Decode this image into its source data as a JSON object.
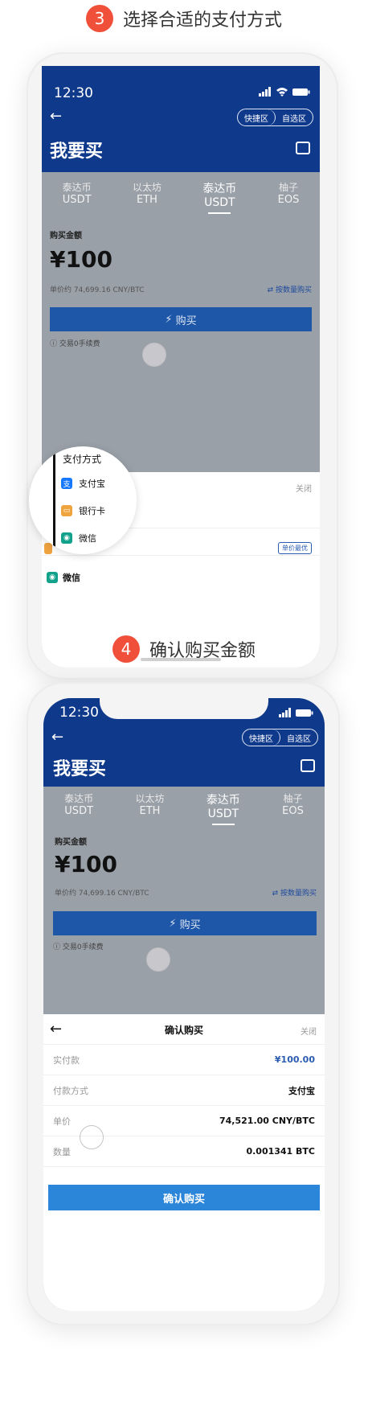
{
  "step3": {
    "num": "3",
    "title": "选择合适的支付方式"
  },
  "step4": {
    "num": "4",
    "title": "确认购买金额"
  },
  "phone1": {
    "time": "12:30",
    "seg": {
      "on": "快捷区",
      "off": "自选区"
    },
    "title": "我要买",
    "coins": [
      {
        "name": "泰达币",
        "sym": "USDT"
      },
      {
        "name": "以太坊",
        "sym": "ETH"
      },
      {
        "name": "泰达币",
        "sym": "USDT",
        "active": true
      },
      {
        "name": "柚子",
        "sym": "EOS"
      }
    ],
    "amount_label": "购买金额",
    "amount": "¥100",
    "rate": "单价约 74,699.16 CNY/BTC",
    "by_qty": "⇄ 按数量购买",
    "buy": "购买",
    "fee": "交易0手续费",
    "sheet": {
      "close": "关闭",
      "tag": "单价最优",
      "wechat": "微信"
    },
    "magnifier": {
      "header": "支付方式",
      "items": [
        {
          "label": "支付宝",
          "icon": "alipay-icon",
          "color": "#1677ff",
          "glyph": "支"
        },
        {
          "label": "银行卡",
          "icon": "bank-card-icon",
          "color": "#f0a440",
          "glyph": "▭"
        },
        {
          "label": "微信",
          "icon": "wechat-icon",
          "color": "#12a28c",
          "glyph": "◉"
        }
      ]
    }
  },
  "phone2": {
    "time": "12:30",
    "seg": {
      "on": "快捷区",
      "off": "自选区"
    },
    "title": "我要买",
    "coins": [
      {
        "name": "泰达币",
        "sym": "USDT"
      },
      {
        "name": "以太坊",
        "sym": "ETH"
      },
      {
        "name": "泰达币",
        "sym": "USDT",
        "active": true
      },
      {
        "name": "柚子",
        "sym": "EOS"
      }
    ],
    "amount_label": "购买金额",
    "amount": "¥100",
    "rate": "单价约 74,699.16 CNY/BTC",
    "by_qty": "⇄ 按数量购买",
    "buy": "购买",
    "fee": "交易0手续费",
    "confirm": {
      "title": "确认购买",
      "close": "关闭",
      "rows": [
        {
          "label": "实付款",
          "value": "¥100.00"
        },
        {
          "label": "付款方式",
          "value": "支付宝"
        },
        {
          "label": "单价",
          "value": "74,521.00 CNY/BTC"
        },
        {
          "label": "数量",
          "value": "0.001341 BTC"
        }
      ],
      "button": "确认购买"
    }
  }
}
